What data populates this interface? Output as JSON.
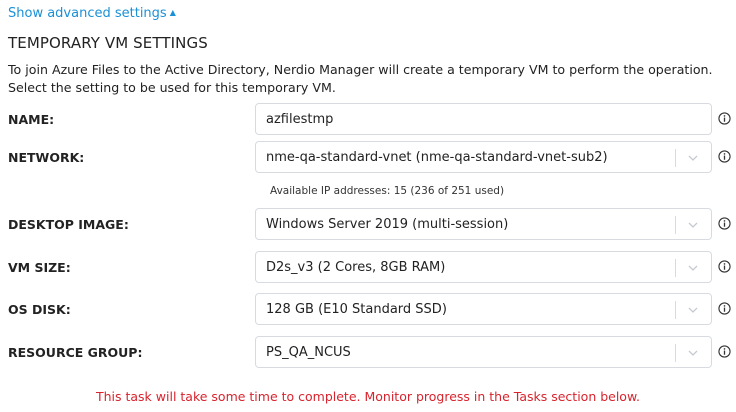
{
  "advanced_toggle": {
    "label": "Show advanced settings",
    "caret_icon": "caret-up-icon"
  },
  "section": {
    "title": "TEMPORARY VM SETTINGS",
    "description": "To join Azure Files to the Active Directory, Nerdio Manager will create a temporary VM to perform the operation. Select the setting to be used for this temporary VM."
  },
  "fields": {
    "name": {
      "label": "NAME:",
      "value": "azfilestmp"
    },
    "network": {
      "label": "NETWORK:",
      "value": "nme-qa-standard-vnet (nme-qa-standard-vnet-sub2)",
      "hint": "Available IP addresses: 15 (236 of 251 used)"
    },
    "desktop_image": {
      "label": "DESKTOP IMAGE:",
      "value": "Windows Server 2019 (multi-session)"
    },
    "vm_size": {
      "label": "VM SIZE:",
      "value": "D2s_v3 (2 Cores, 8GB RAM)"
    },
    "os_disk": {
      "label": "OS DISK:",
      "value": "128 GB (E10 Standard SSD)"
    },
    "resource_group": {
      "label": "RESOURCE GROUP:",
      "value": "PS_QA_NCUS"
    }
  },
  "notice": "This task will take some time to complete. Monitor progress in the Tasks section below.",
  "colors": {
    "link": "#1a90d6",
    "warning": "#d9232d",
    "border": "#d7dbe0"
  }
}
